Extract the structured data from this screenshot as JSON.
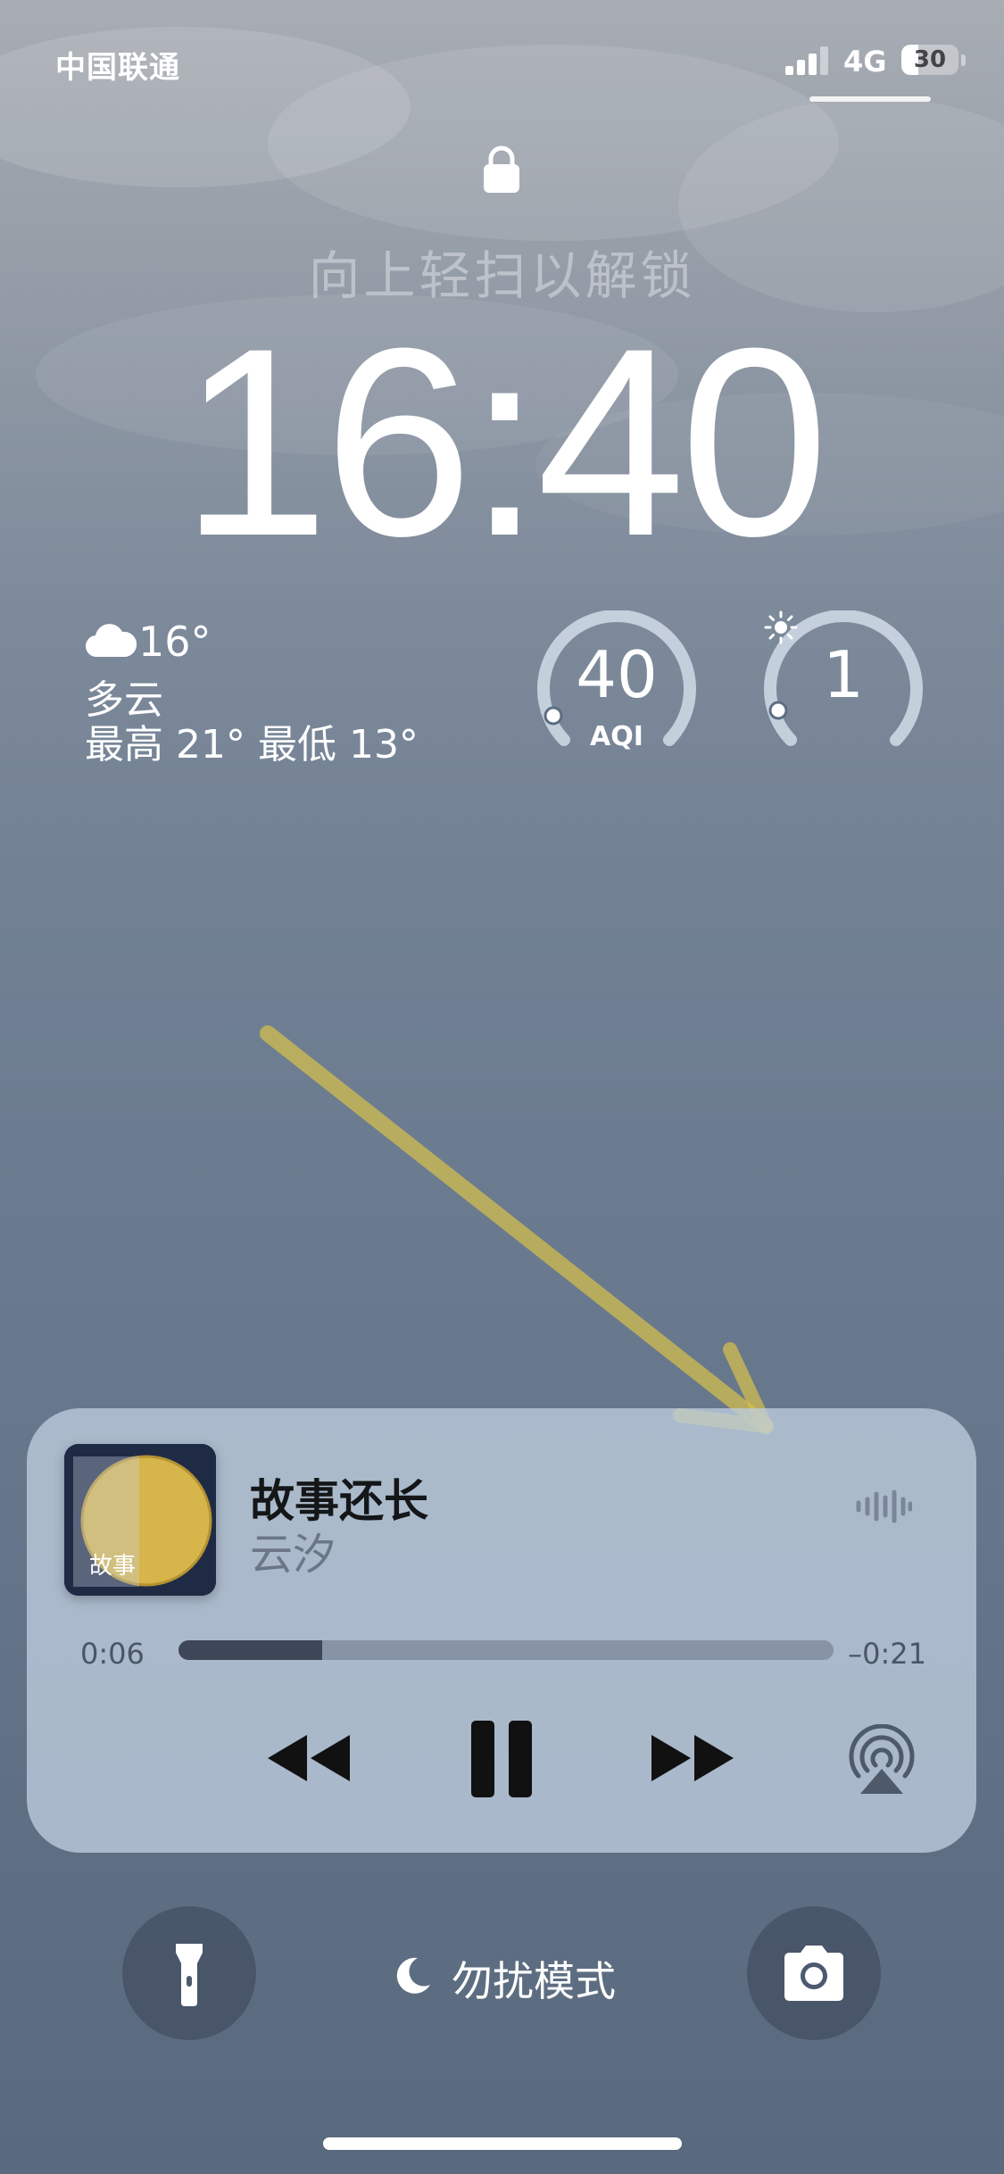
{
  "status_bar": {
    "carrier": "中国联通",
    "network": "4G",
    "battery": "30",
    "battery_level": 0.3
  },
  "lock_screen": {
    "unlock_hint": "向上轻扫以解锁",
    "time": "16:40"
  },
  "weather": {
    "icon": "cloud-icon",
    "temperature": "16°",
    "condition": "多云",
    "range": "最高 21° 最低 13°"
  },
  "widgets": {
    "aqi": {
      "value": "40",
      "label": "AQI",
      "level": 0.1
    },
    "uv": {
      "value": "1",
      "icon": "sun-icon",
      "level": 0.08
    }
  },
  "now_playing": {
    "title": "故事还长",
    "artist": "云汐",
    "elapsed": "0:06",
    "remaining": "–0:21",
    "progress": 0.22,
    "controls": [
      "rewind-icon",
      "pause-icon",
      "fast-forward-icon",
      "airplay-icon"
    ],
    "album_art_text": "故事"
  },
  "quick_actions": {
    "left": "flashlight-icon",
    "focus_icon": "moon-icon",
    "focus_label": "勿扰模式",
    "right": "camera-icon"
  },
  "colors": {
    "annotation_arrow": "#d8c24a",
    "player_bg": "#bccbdd",
    "progress_fill": "#3d4757"
  }
}
